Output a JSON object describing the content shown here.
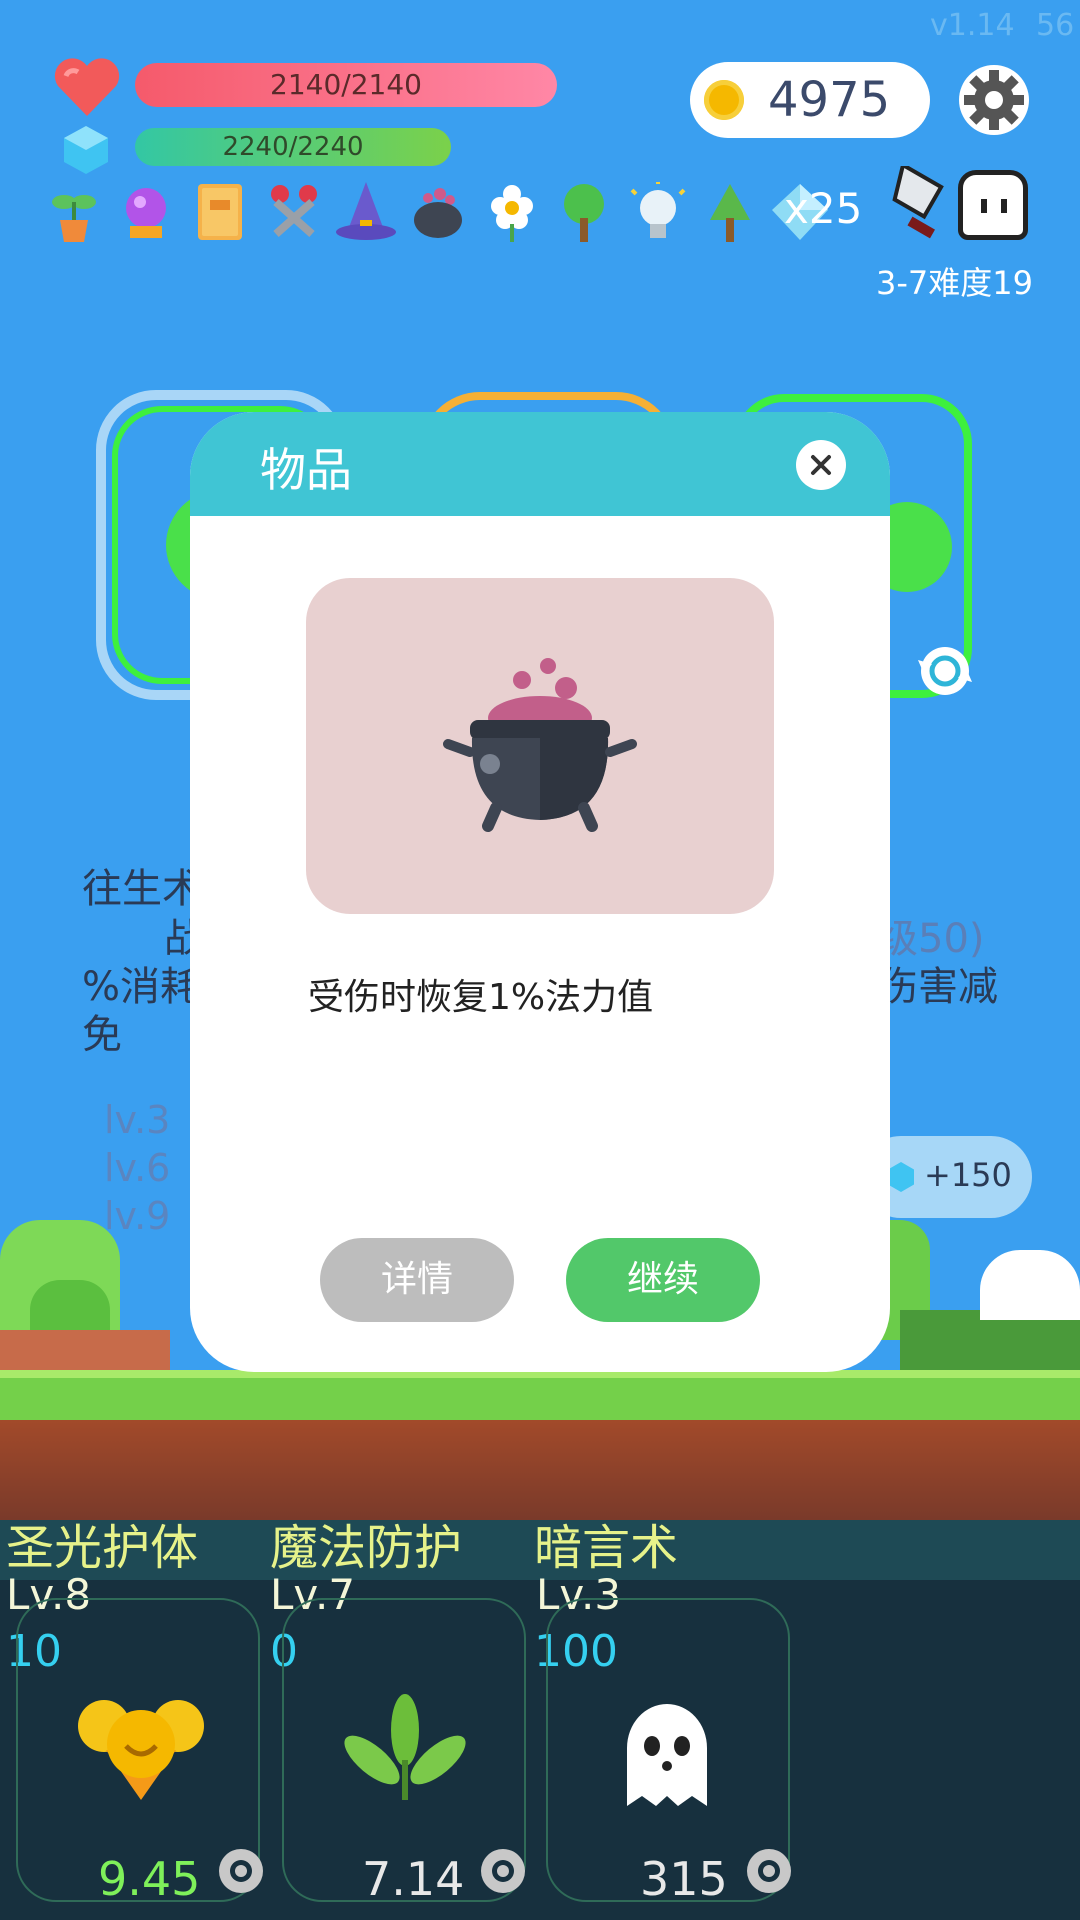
{
  "version": "v1.14",
  "fps": "56",
  "hp_text": "2140/2140",
  "mp_text": "2240/2240",
  "coins": "4975",
  "gem_count": "x25",
  "stage": "3-7难度19",
  "bg_text": {
    "left_line1": "往生术",
    "left_line2": "战",
    "left_line3": "%消耗",
    "left_line4": "免",
    "right_line1": "级50)",
    "right_line2": "伤害减",
    "lv3": "lv.3",
    "lv6": "lv.6",
    "lv9": "lv.9",
    "bonus": "+150"
  },
  "modal": {
    "title": "物品",
    "description": "受伤时恢复1%法力值",
    "details_label": "详情",
    "continue_label": "继续"
  },
  "skills": [
    {
      "name": "圣光护体",
      "level": "Lv.8",
      "cost": "10",
      "value": "9.45"
    },
    {
      "name": "魔法防护",
      "level": "Lv.7",
      "cost": "0",
      "value": "7.14"
    },
    {
      "name": "暗言术",
      "level": "Lv.3",
      "cost": "100",
      "value": "315"
    }
  ],
  "colors": {
    "sky": "#3a9ff0",
    "modal_header": "#40c5d4",
    "continue_btn": "#52c86a",
    "details_btn": "#bdbdbd"
  }
}
